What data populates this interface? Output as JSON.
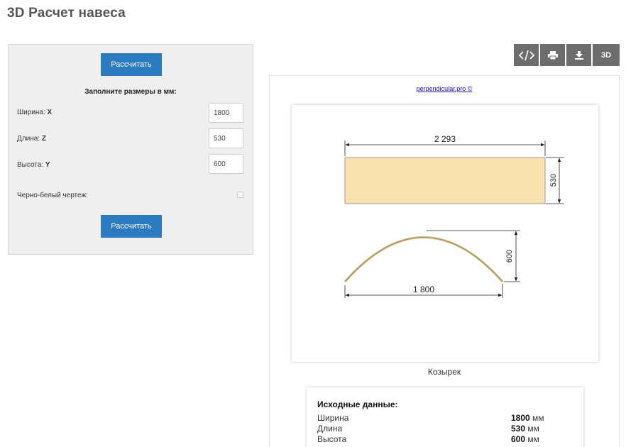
{
  "page": {
    "title": "3D Расчет навеса"
  },
  "form": {
    "calculate_label": "Рассчитать",
    "heading": "Заполните размеры в мм:",
    "fields": [
      {
        "label": "Ширина:",
        "axis": "X",
        "value": "1800"
      },
      {
        "label": "Длина:",
        "axis": "Z",
        "value": "530"
      },
      {
        "label": "Высота:",
        "axis": "Y",
        "value": "600"
      }
    ],
    "bw_label": "Черно-белый чертеж:",
    "bw_checked": false
  },
  "toolbar": {
    "code_icon": "code-icon",
    "print_icon": "print-icon",
    "download_icon": "download-icon",
    "label_3d": "3D"
  },
  "drawing": {
    "credit": "perpendicular.pro ©",
    "top_view": {
      "length_label": "2 293",
      "depth_label": "530",
      "fill_color": "#fbe3b0"
    },
    "side_view": {
      "width_label": "1 800",
      "height_label": "600",
      "stroke_color": "#c8b57a"
    },
    "caption": "Козырек"
  },
  "source_data": {
    "title": "Исходные данные:",
    "rows": [
      {
        "label": "Ширина",
        "value": "1800",
        "unit": "мм"
      },
      {
        "label": "Длина",
        "value": "530",
        "unit": "мм"
      },
      {
        "label": "Высота",
        "value": "600",
        "unit": "мм"
      }
    ]
  }
}
